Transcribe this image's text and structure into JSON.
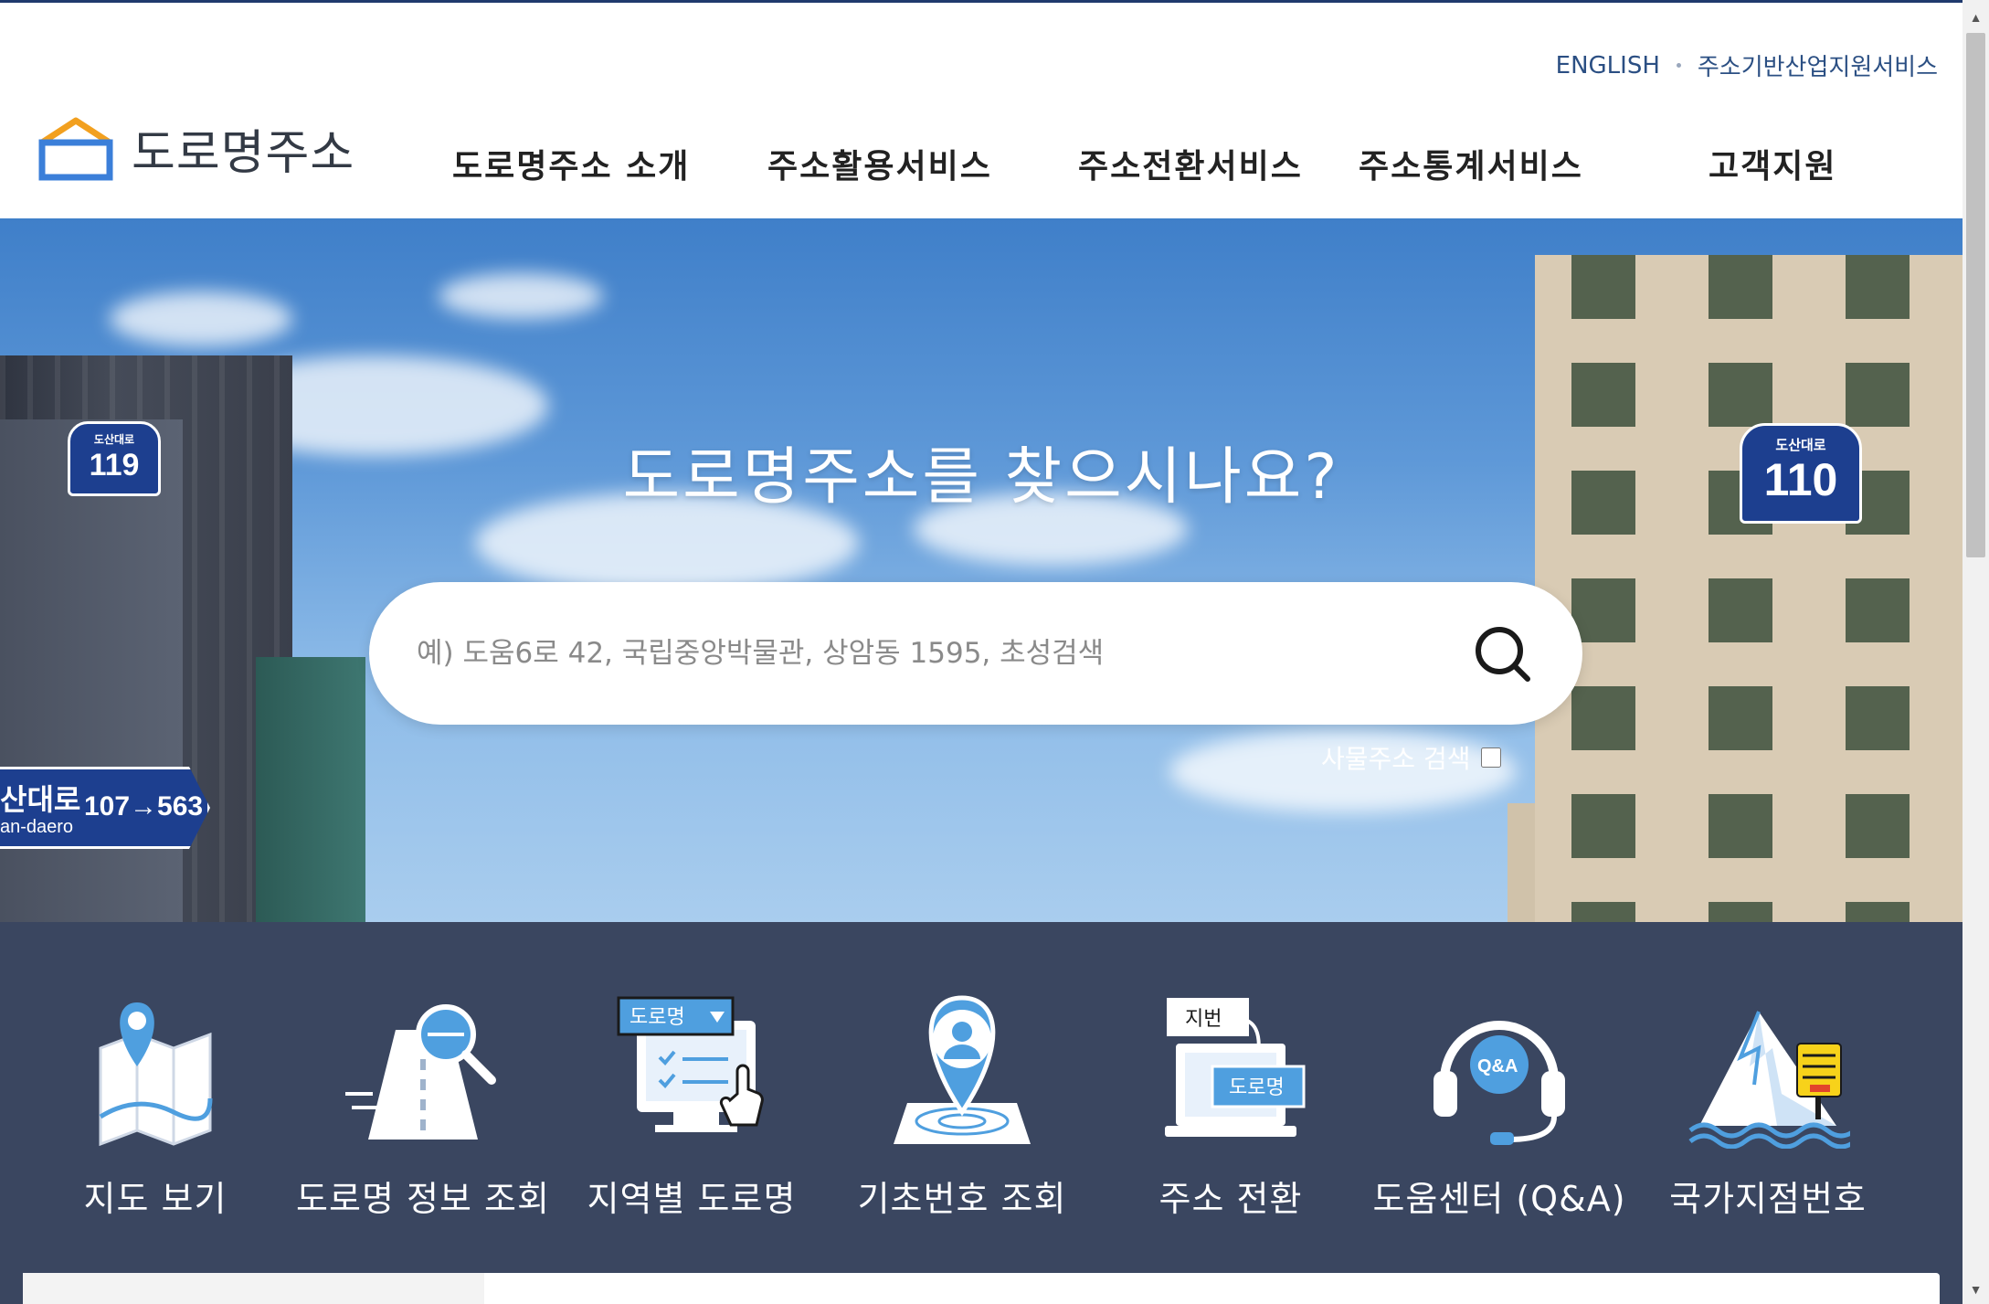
{
  "header": {
    "util_links": [
      {
        "label": "ENGLISH"
      },
      {
        "label": "주소기반산업지원서비스"
      }
    ],
    "logo_text": "도로명주소",
    "nav": [
      {
        "label": "도로명주소 소개"
      },
      {
        "label": "주소활용서비스"
      },
      {
        "label": "주소전환서비스"
      },
      {
        "label": "주소통계서비스"
      },
      {
        "label": "고객지원"
      }
    ]
  },
  "hero": {
    "title": "도로명주소를 찾으시나요?",
    "search": {
      "placeholder": "예) 도움6로 42, 국립중앙박물관, 상암동 1595, 초성검색",
      "value": ""
    },
    "thing_search": {
      "label": "사물주소 검색",
      "checked": false
    },
    "signs": {
      "left_small": "도산대로",
      "left_num": "119",
      "right_small": "도산대로",
      "right_num": "110",
      "road_name": "산대로",
      "road_en": "an-daero",
      "road_num": "107→563"
    }
  },
  "quick_menu": [
    {
      "label": "지도 보기",
      "icon": "map-icon"
    },
    {
      "label": "도로명 정보 조회",
      "icon": "road-search-icon"
    },
    {
      "label": "지역별 도로명",
      "icon": "region-road-icon",
      "badge": "도로명"
    },
    {
      "label": "기초번호 조회",
      "icon": "base-number-icon"
    },
    {
      "label": "주소 전환",
      "icon": "address-convert-icon",
      "badge_from": "지번",
      "badge_to": "도로명"
    },
    {
      "label": "도움센터 (Q&A)",
      "icon": "helpdesk-icon",
      "badge": "Q&A"
    },
    {
      "label": "국가지점번호",
      "icon": "national-point-icon"
    }
  ],
  "colors": {
    "accent": "#1f3a6d",
    "link": "#2b4f83",
    "quick_bg": "#3a4660",
    "sign_blue": "#1d3f8f",
    "icon_blue": "#4f9fdf"
  }
}
